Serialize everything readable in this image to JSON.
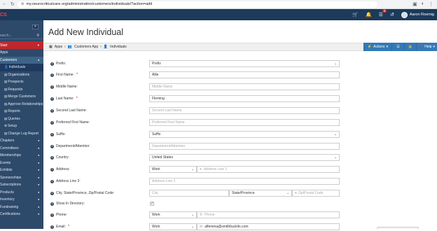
{
  "browser": {
    "url": "my.neurocriticalcare.org/administration/customers/individuals/?action=add"
  },
  "app": {
    "logo": "CS",
    "user_name": "Aaron Roemig",
    "badge_count": "5"
  },
  "sidebar": {
    "search_placeholder": "earch...",
    "start": "Start",
    "items": [
      {
        "label": "Apps",
        "sub": false,
        "arrow": ""
      },
      {
        "label": "Customers",
        "sub": false,
        "arrow": "◂",
        "customers": true
      },
      {
        "label": "Individuals",
        "sub": true,
        "arrow": "",
        "active": true,
        "icon": "👤"
      },
      {
        "label": "Organizations",
        "sub": true,
        "arrow": "",
        "icon": "▤"
      },
      {
        "label": "Prospects",
        "sub": true,
        "arrow": "",
        "icon": "▤"
      },
      {
        "label": "Requests",
        "sub": true,
        "arrow": "",
        "icon": "▤"
      },
      {
        "label": "Merge Customers",
        "sub": true,
        "arrow": "",
        "icon": "▤"
      },
      {
        "label": "Approve Relationships",
        "sub": true,
        "arrow": "",
        "icon": "▤"
      },
      {
        "label": "Reports",
        "sub": true,
        "arrow": "",
        "icon": "▤"
      },
      {
        "label": "Queries",
        "sub": true,
        "arrow": "",
        "icon": "▤"
      },
      {
        "label": "Setup",
        "sub": true,
        "arrow": "",
        "icon": "⚙"
      },
      {
        "label": "Change Log Report",
        "sub": true,
        "arrow": "",
        "icon": "▤"
      },
      {
        "label": "Chapters",
        "sub": false,
        "arrow": "◂"
      },
      {
        "label": "Committees",
        "sub": false,
        "arrow": "◂"
      },
      {
        "label": "Memberships",
        "sub": false,
        "arrow": "◂"
      },
      {
        "label": "Events",
        "sub": false,
        "arrow": "◂"
      },
      {
        "label": "Exhibits",
        "sub": false,
        "arrow": "◂"
      },
      {
        "label": "Sponsorships",
        "sub": false,
        "arrow": "◂"
      },
      {
        "label": "Subscriptions",
        "sub": false,
        "arrow": "◂"
      },
      {
        "label": "Products",
        "sub": false,
        "arrow": "◂"
      },
      {
        "label": "Inventory",
        "sub": false,
        "arrow": "◂"
      },
      {
        "label": "Fundraising",
        "sub": false,
        "arrow": "◂"
      },
      {
        "label": "Certifications",
        "sub": false,
        "arrow": "◂"
      }
    ]
  },
  "page": {
    "title": "Add New Individual",
    "breadcrumb": {
      "apps": "Apps",
      "customers_app": "Customers App",
      "individuals": "Individuals"
    },
    "actions_label": "Actions",
    "help_label": "Help"
  },
  "form": {
    "prefix": {
      "label": "Prefix:",
      "value": "Prefix"
    },
    "first_name": {
      "label": "First Name:",
      "value": "Allie"
    },
    "middle_name": {
      "label": "Middle Name:",
      "placeholder": "Middle Name"
    },
    "last_name": {
      "label": "Last Name:",
      "value": "Fleming"
    },
    "second_last_name": {
      "label": "Second Last Name:",
      "placeholder": "Second Last Name"
    },
    "preferred_first_name": {
      "label": "Preferred First Name:",
      "placeholder": "Preferred First Name"
    },
    "suffix": {
      "label": "Suffix:",
      "value": "Suffix"
    },
    "department": {
      "label": "Department/Attention:",
      "placeholder": "Department/Attention"
    },
    "country": {
      "label": "Country:",
      "value": "United States"
    },
    "address": {
      "label": "Address:",
      "type": "Work",
      "placeholder": "Address Line 1"
    },
    "address2": {
      "label": "Address Line 2:",
      "placeholder": "Address Line 2"
    },
    "city_state_zip": {
      "label": "City, State/Province, Zip/Postal Code:",
      "city_placeholder": "City",
      "state_value": "State/Province",
      "zip_placeholder": "Zip/Postal Code"
    },
    "show_in_directory": {
      "label": "Show In Directory:",
      "checked": "✓"
    },
    "phone": {
      "label": "Phone:",
      "type": "Work",
      "placeholder": "Phone"
    },
    "email": {
      "label": "Email:",
      "type": "Work",
      "value": "alfemina@smithbucklin.com"
    }
  },
  "colors": {
    "topbar": "#1c3a5a",
    "sidebar": "#2e4a6b",
    "start": "#c0272d",
    "primary": "#337ab7"
  }
}
